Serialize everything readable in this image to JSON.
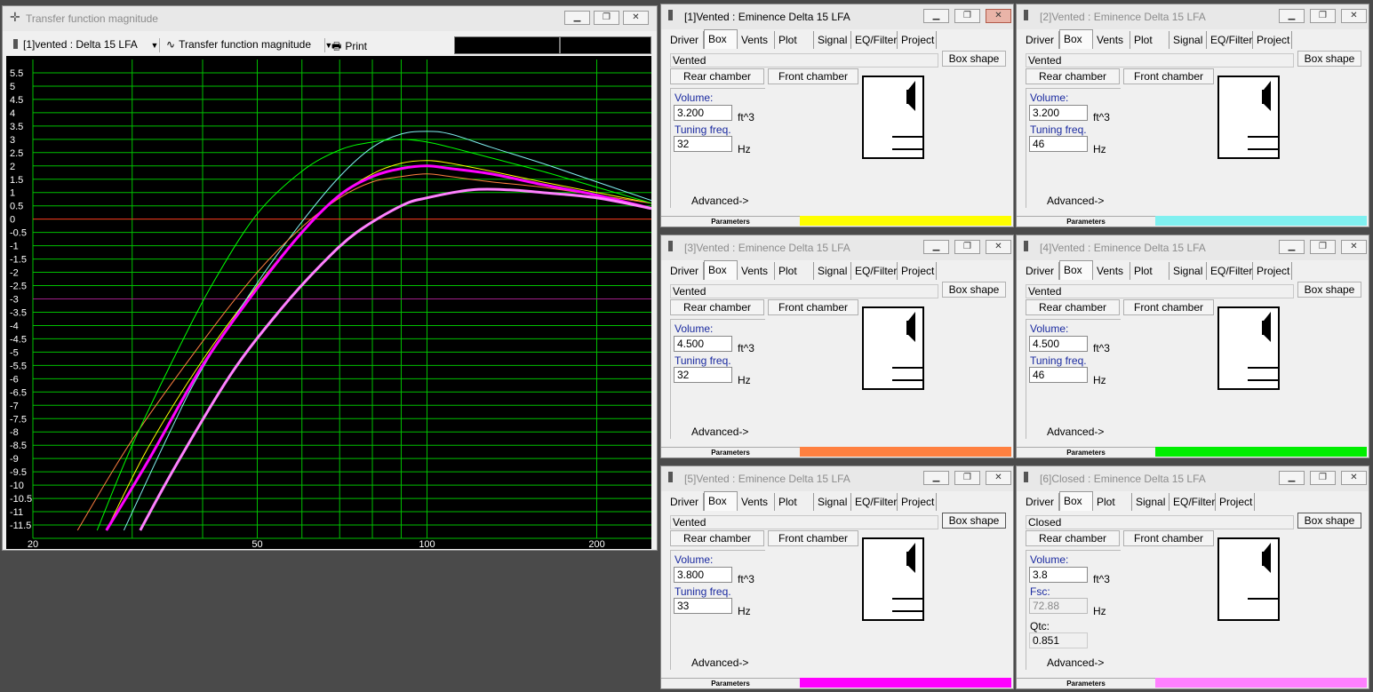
{
  "graph_window": {
    "title": "Transfer function magnitude",
    "driver_select": "[1]vented : Delta 15 LFA",
    "plot_select": "Transfer function magnitude",
    "print_label": "Print"
  },
  "chart_data": {
    "type": "line",
    "xscale": "log",
    "xlim": [
      20,
      250
    ],
    "ylim": [
      -12,
      6
    ],
    "x_ticks": [
      "20",
      "50",
      "100",
      "200"
    ],
    "y_ticks": [
      "5.5",
      "5",
      "4.5",
      "4",
      "3.5",
      "3",
      "2.5",
      "2",
      "1.5",
      "1",
      "0.5",
      "0",
      "-0.5",
      "-1",
      "-1.5",
      "-2",
      "-2.5",
      "-3",
      "-3.5",
      "-4",
      "-4.5",
      "-5",
      "-5.5",
      "-6",
      "-6.5",
      "-7",
      "-7.5",
      "-8",
      "-8.5",
      "-9",
      "-9.5",
      "-10",
      "-10.5",
      "-11",
      "-11.5"
    ],
    "ref_lines": [
      {
        "y": 0,
        "color": "#ff2020"
      },
      {
        "y": -3,
        "color": "#a0208a"
      }
    ],
    "grid": true,
    "background": "#000000",
    "grid_color": "#00c000",
    "series": [
      {
        "color": "#ffff00",
        "width": 1,
        "x": [
          27,
          32,
          40,
          50,
          60,
          70,
          80,
          90,
          100,
          110,
          130,
          160,
          200,
          250
        ],
        "y": [
          -11.7,
          -8.6,
          -5.3,
          -2.5,
          -0.5,
          0.9,
          1.7,
          2.1,
          2.2,
          2.1,
          1.8,
          1.4,
          1.0,
          0.6
        ]
      },
      {
        "color": "#80f0f0",
        "width": 1,
        "x": [
          29,
          35,
          40,
          50,
          60,
          70,
          80,
          90,
          100,
          110,
          130,
          160,
          200,
          250
        ],
        "y": [
          -11.7,
          -8.0,
          -5.6,
          -2.4,
          -0.1,
          1.6,
          2.7,
          3.2,
          3.3,
          3.2,
          2.7,
          2.1,
          1.4,
          0.7
        ]
      },
      {
        "color": "#ff8040",
        "width": 1,
        "x": [
          24,
          30,
          40,
          50,
          60,
          70,
          80,
          90,
          100,
          110,
          130,
          160,
          200,
          250
        ],
        "y": [
          -11.7,
          -8.3,
          -4.6,
          -2.0,
          -0.3,
          0.8,
          1.4,
          1.6,
          1.7,
          1.6,
          1.4,
          1.2,
          0.9,
          0.6
        ]
      },
      {
        "color": "#00ff00",
        "width": 1,
        "x": [
          26,
          30,
          36,
          42,
          50,
          60,
          70,
          80,
          90,
          100,
          110,
          130,
          160,
          200,
          250
        ],
        "y": [
          -11.7,
          -8.5,
          -5.0,
          -2.3,
          0.2,
          1.8,
          2.6,
          2.9,
          3.0,
          2.9,
          2.7,
          2.3,
          1.8,
          1.2,
          0.6
        ]
      },
      {
        "color": "#ff00ff",
        "width": 3,
        "x": [
          27,
          32,
          40,
          50,
          60,
          70,
          80,
          90,
          100,
          110,
          130,
          160,
          200,
          250
        ],
        "y": [
          -11.7,
          -9.1,
          -5.5,
          -2.6,
          -0.5,
          0.9,
          1.6,
          1.9,
          2.0,
          1.9,
          1.7,
          1.3,
          0.9,
          0.4
        ]
      },
      {
        "color": "#ff80ff",
        "width": 3,
        "x": [
          31,
          36,
          45,
          55,
          65,
          75,
          90,
          100,
          120,
          140,
          160,
          200,
          250
        ],
        "y": [
          -11.7,
          -9.2,
          -5.8,
          -3.4,
          -1.7,
          -0.5,
          0.5,
          0.8,
          1.1,
          1.1,
          1.0,
          0.8,
          0.4
        ]
      }
    ]
  },
  "panels": [
    {
      "title": "[1]Vented : Eminence  Delta 15 LFA",
      "tabs": [
        "Driver",
        "Box",
        "Vents",
        "Plot",
        "Signal",
        "EQ/Filter",
        "Project"
      ],
      "box_type": "Vented",
      "box_shape": "Box shape",
      "rear": "Rear chamber",
      "front": "Front chamber",
      "vol_label": "Volume:",
      "volume": "3.200",
      "vol_unit": "ft^3",
      "tune_label": "Tuning freq.",
      "tuning": "32",
      "tune_unit": "Hz",
      "advanced": "Advanced->",
      "params": "Parameters",
      "color": "#ffff00"
    },
    {
      "title": "[2]Vented : Eminence  Delta 15 LFA",
      "tabs": [
        "Driver",
        "Box",
        "Vents",
        "Plot",
        "Signal",
        "EQ/Filter",
        "Project"
      ],
      "box_type": "Vented",
      "box_shape": "Box shape",
      "rear": "Rear chamber",
      "front": "Front chamber",
      "vol_label": "Volume:",
      "volume": "3.200",
      "vol_unit": "ft^3",
      "tune_label": "Tuning freq.",
      "tuning": "46",
      "tune_unit": "Hz",
      "advanced": "Advanced->",
      "params": "Parameters",
      "color": "#80f0f0"
    },
    {
      "title": "[3]Vented : Eminence  Delta 15 LFA",
      "tabs": [
        "Driver",
        "Box",
        "Vents",
        "Plot",
        "Signal",
        "EQ/Filter",
        "Project"
      ],
      "box_type": "Vented",
      "box_shape": "Box shape",
      "rear": "Rear chamber",
      "front": "Front chamber",
      "vol_label": "Volume:",
      "volume": "4.500",
      "vol_unit": "ft^3",
      "tune_label": "Tuning freq.",
      "tuning": "32",
      "tune_unit": "Hz",
      "advanced": "Advanced->",
      "params": "Parameters",
      "color": "#ff8040"
    },
    {
      "title": "[4]Vented : Eminence  Delta 15 LFA",
      "tabs": [
        "Driver",
        "Box",
        "Vents",
        "Plot",
        "Signal",
        "EQ/Filter",
        "Project"
      ],
      "box_type": "Vented",
      "box_shape": "Box shape",
      "rear": "Rear chamber",
      "front": "Front chamber",
      "vol_label": "Volume:",
      "volume": "4.500",
      "vol_unit": "ft^3",
      "tune_label": "Tuning freq.",
      "tuning": "46",
      "tune_unit": "Hz",
      "advanced": "Advanced->",
      "params": "Parameters",
      "color": "#00ee00"
    },
    {
      "title": "[5]Vented : Eminence  Delta 15 LFA",
      "tabs": [
        "Driver",
        "Box",
        "Vents",
        "Plot",
        "Signal",
        "EQ/Filter",
        "Project"
      ],
      "box_type": "Vented",
      "box_shape": "Box shape",
      "rear": "Rear chamber",
      "front": "Front chamber",
      "vol_label": "Volume:",
      "volume": "3.800",
      "vol_unit": "ft^3",
      "tune_label": "Tuning freq.",
      "tuning": "33",
      "tune_unit": "Hz",
      "advanced": "Advanced->",
      "params": "Parameters",
      "color": "#ff00ff"
    },
    {
      "title": "[6]Closed : Eminence  Delta 15 LFA",
      "tabs": [
        "Driver",
        "Box",
        "Plot",
        "Signal",
        "EQ/Filter",
        "Project"
      ],
      "box_type": "Closed",
      "box_shape": "Box shape",
      "rear": "Rear chamber",
      "front": "Front chamber",
      "vol_label": "Volume:",
      "volume": "3.8",
      "vol_unit": "ft^3",
      "tune_label": "Fsc:",
      "tuning": "72.88",
      "tune_unit": "Hz",
      "qtc_label": "Qtc:",
      "qtc": "0.851",
      "advanced": "Advanced->",
      "params": "Parameters",
      "color": "#ff80ff"
    }
  ]
}
